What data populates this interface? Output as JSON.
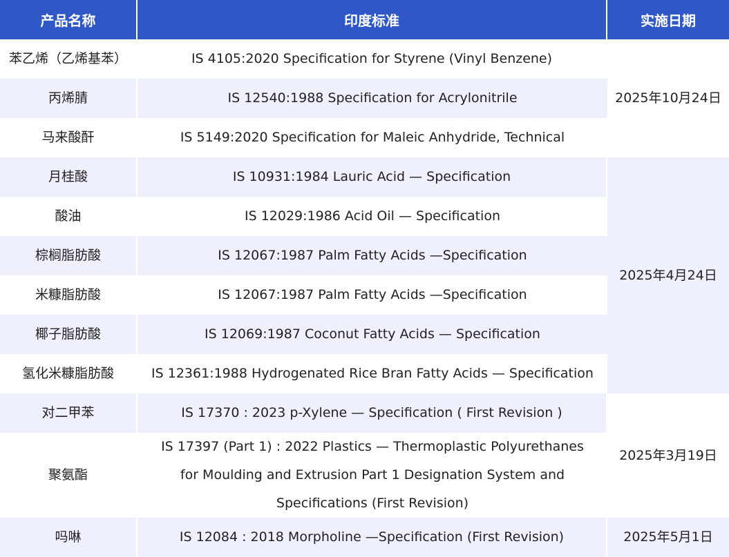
{
  "header": {
    "col_product": "产品名称",
    "col_standard": "印度标准",
    "col_date": "实施日期"
  },
  "rows": [
    {
      "product": "苯乙烯（乙烯基苯）",
      "standard": "IS 4105:2020 Specification for Styrene (Vinyl Benzene)"
    },
    {
      "product": "丙烯腈",
      "standard": "IS 12540:1988 Specification for Acrylonitrile"
    },
    {
      "product": "马来酸酐",
      "standard": "IS 5149:2020 Specification for Maleic Anhydride, Technical"
    },
    {
      "product": "月桂酸",
      "standard": "IS 10931:1984 Lauric Acid — Specification"
    },
    {
      "product": "酸油",
      "standard": "IS 12029:1986 Acid Oil — Specification"
    },
    {
      "product": "棕榈脂肪酸",
      "standard": "IS 12067:1987 Palm Fatty Acids —Specification"
    },
    {
      "product": "米糠脂肪酸",
      "standard": "IS 12067:1987 Palm Fatty Acids —Specification"
    },
    {
      "product": "椰子脂肪酸",
      "standard": "IS 12069:1987 Coconut Fatty Acids — Specification"
    },
    {
      "product": "氢化米糠脂肪酸",
      "standard": "IS 12361:1988 Hydrogenated Rice Bran Fatty Acids — Specification"
    },
    {
      "product": "对二甲苯",
      "standard": "IS 17370 : 2023 p-Xylene — Specification ( First Revision )"
    },
    {
      "product": "聚氨酯",
      "standard_lines": [
        "IS 17397 (Part 1) : 2022 Plastics — Thermoplastic Polyurethanes",
        "for Moulding and Extrusion Part 1 Designation System and",
        "Specifications (First Revision)"
      ]
    },
    {
      "product": "吗啉",
      "standard": "IS 12084 : 2018 Morpholine —Specification (First Revision)"
    }
  ],
  "dates": {
    "group1": "2025年10月24日",
    "group2": "2025年4月24日",
    "group3": "2025年3月19日",
    "group4": "2025年5月1日"
  },
  "colors": {
    "header_bg": "#2f58c6",
    "stripe_bg": "#eef1fc"
  }
}
